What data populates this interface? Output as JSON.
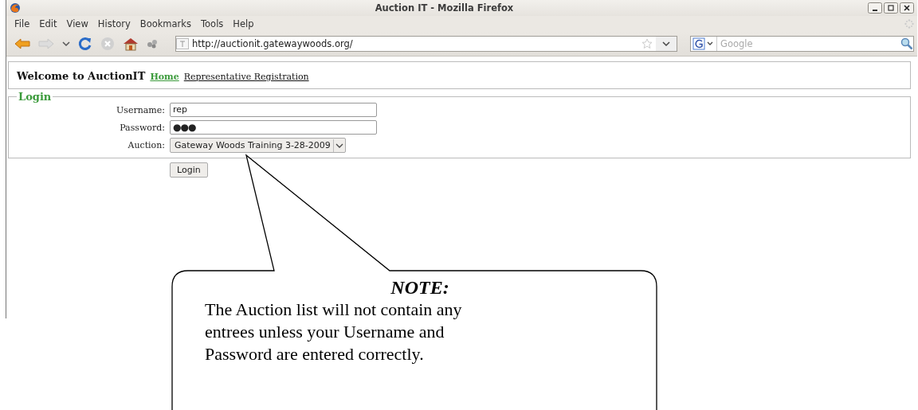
{
  "window": {
    "title": "Auction IT - Mozilla Firefox"
  },
  "menu": [
    "File",
    "Edit",
    "View",
    "History",
    "Bookmarks",
    "Tools",
    "Help"
  ],
  "toolbar": {
    "url": "http://auctionit.gatewaywoods.org/",
    "search_placeholder": "Google"
  },
  "page": {
    "heading": "Welcome to AuctionIT",
    "links": [
      {
        "label": "Home",
        "selected": true
      },
      {
        "label": "Representative Registration",
        "selected": false
      }
    ],
    "login": {
      "legend": "Login",
      "fields": [
        {
          "kind": "text",
          "label": "Username:",
          "value": "rep"
        },
        {
          "kind": "password",
          "label": "Password:",
          "value": "●●●"
        },
        {
          "kind": "select",
          "label": "Auction:",
          "value": "Gateway Woods Training 3-28-2009"
        }
      ],
      "button": "Login"
    }
  },
  "callout": {
    "title": "NOTE:",
    "text": "The Auction list will not contain any entrees unless your Username and Password are entered correctly."
  }
}
